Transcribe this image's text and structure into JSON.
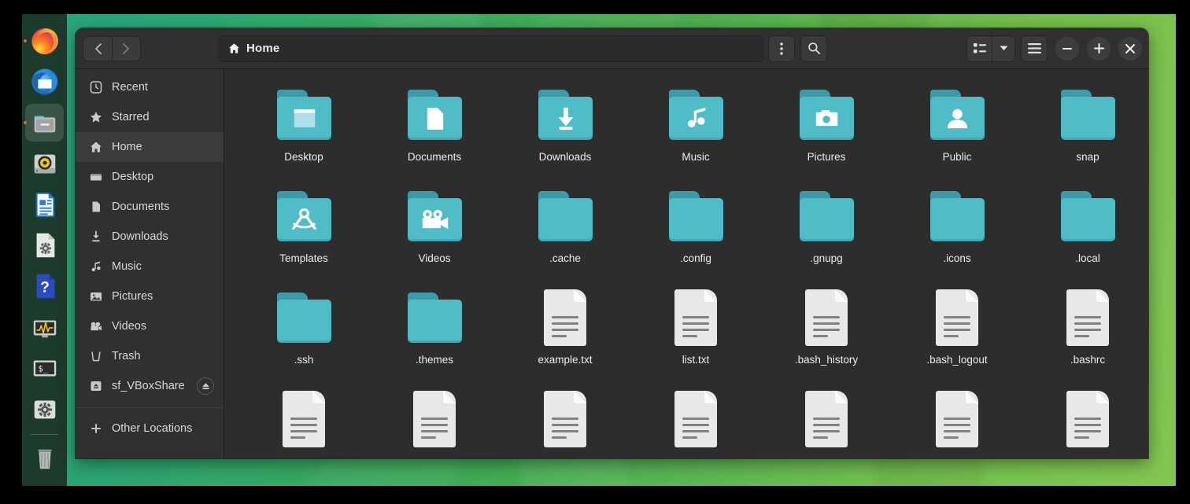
{
  "theme": {
    "desktop_gradient_left": "#18a07a",
    "desktop_gradient_right": "#79c245",
    "dock_bg": "#1d3b2d",
    "window_bg": "#2d2d2d",
    "header_bg": "#303030",
    "sidebar_bg": "#303030",
    "folder_teal": "#4fbcc7",
    "folder_tab_teal": "#3d9aa6",
    "accent_running_dot": "#e8662a",
    "text_primary": "#ececec"
  },
  "dock": {
    "items": [
      {
        "name": "firefox",
        "label": "Firefox",
        "running": true,
        "active": false
      },
      {
        "name": "thunderbird",
        "label": "Thunderbird Mail",
        "running": false,
        "active": false
      },
      {
        "name": "files",
        "label": "Files",
        "running": true,
        "active": true
      },
      {
        "name": "rhythmbox",
        "label": "Rhythmbox",
        "running": false,
        "active": false
      },
      {
        "name": "libreoffice-writer",
        "label": "LibreOffice Writer",
        "running": false,
        "active": false
      },
      {
        "name": "software-installer",
        "label": "Software Install",
        "running": false,
        "active": false
      },
      {
        "name": "help",
        "label": "Help",
        "running": false,
        "active": false
      },
      {
        "name": "system-monitor",
        "label": "System Monitor",
        "running": false,
        "active": false
      },
      {
        "name": "terminal",
        "label": "Terminal",
        "running": false,
        "active": false
      },
      {
        "name": "settings",
        "label": "Settings",
        "running": false,
        "active": false
      },
      {
        "name": "trash",
        "label": "Trash",
        "running": false,
        "active": false
      }
    ]
  },
  "window": {
    "title": "Home",
    "header": {
      "back_tooltip": "Back",
      "forward_tooltip": "Forward",
      "breadcrumb_label": "Home",
      "breadcrumb_icon": "home-icon",
      "menu_icon": "three-dots-vertical-icon",
      "search_icon": "search-icon",
      "view_list_icon": "list-view-icon",
      "view_dropdown_icon": "chevron-down-icon",
      "hamburger_icon": "hamburger-menu-icon",
      "minimize_label": "–",
      "maximize_label": "+",
      "close_label": "×"
    }
  },
  "sidebar": {
    "items": [
      {
        "label": "Recent",
        "icon": "clock-icon",
        "selected": false,
        "eject": false
      },
      {
        "label": "Starred",
        "icon": "star-icon",
        "selected": false,
        "eject": false
      },
      {
        "label": "Home",
        "icon": "home-icon",
        "selected": true,
        "eject": false
      },
      {
        "label": "Desktop",
        "icon": "desktop-icon",
        "selected": false,
        "eject": false
      },
      {
        "label": "Documents",
        "icon": "document-icon",
        "selected": false,
        "eject": false
      },
      {
        "label": "Downloads",
        "icon": "download-icon",
        "selected": false,
        "eject": false
      },
      {
        "label": "Music",
        "icon": "music-note-icon",
        "selected": false,
        "eject": false
      },
      {
        "label": "Pictures",
        "icon": "image-icon",
        "selected": false,
        "eject": false
      },
      {
        "label": "Videos",
        "icon": "video-camera-icon",
        "selected": false,
        "eject": false
      },
      {
        "label": "Trash",
        "icon": "trash-icon",
        "selected": false,
        "eject": false
      },
      {
        "label": "sf_VBoxShare",
        "icon": "drive-icon",
        "selected": false,
        "eject": true
      }
    ],
    "other_locations": {
      "label": "Other Locations",
      "icon": "plus-icon"
    }
  },
  "files": {
    "items": [
      {
        "label": "Desktop",
        "type": "folder",
        "emblem": "window-emblem"
      },
      {
        "label": "Documents",
        "type": "folder",
        "emblem": "document-emblem"
      },
      {
        "label": "Downloads",
        "type": "folder",
        "emblem": "download-emblem"
      },
      {
        "label": "Music",
        "type": "folder",
        "emblem": "music-emblem"
      },
      {
        "label": "Pictures",
        "type": "folder",
        "emblem": "camera-emblem"
      },
      {
        "label": "Public",
        "type": "folder",
        "emblem": "person-emblem"
      },
      {
        "label": "snap",
        "type": "folder",
        "emblem": "none"
      },
      {
        "label": "Templates",
        "type": "folder",
        "emblem": "compass-emblem"
      },
      {
        "label": "Videos",
        "type": "folder",
        "emblem": "movie-camera-emblem"
      },
      {
        "label": ".cache",
        "type": "folder",
        "emblem": "none"
      },
      {
        "label": ".config",
        "type": "folder",
        "emblem": "none"
      },
      {
        "label": ".gnupg",
        "type": "folder",
        "emblem": "none"
      },
      {
        "label": ".icons",
        "type": "folder",
        "emblem": "none"
      },
      {
        "label": ".local",
        "type": "folder",
        "emblem": "none"
      },
      {
        "label": ".ssh",
        "type": "folder",
        "emblem": "none"
      },
      {
        "label": ".themes",
        "type": "folder",
        "emblem": "none"
      },
      {
        "label": "example.txt",
        "type": "file",
        "emblem": "none"
      },
      {
        "label": "list.txt",
        "type": "file",
        "emblem": "none"
      },
      {
        "label": ".bash_history",
        "type": "file",
        "emblem": "none"
      },
      {
        "label": ".bash_logout",
        "type": "file",
        "emblem": "none"
      },
      {
        "label": ".bashrc",
        "type": "file",
        "emblem": "none"
      },
      {
        "label": "",
        "type": "file",
        "emblem": "none"
      },
      {
        "label": "",
        "type": "file",
        "emblem": "none"
      },
      {
        "label": "",
        "type": "file",
        "emblem": "none"
      },
      {
        "label": "",
        "type": "file",
        "emblem": "none"
      },
      {
        "label": "",
        "type": "file",
        "emblem": "none"
      },
      {
        "label": "",
        "type": "file",
        "emblem": "none"
      },
      {
        "label": "",
        "type": "file",
        "emblem": "none"
      }
    ]
  }
}
